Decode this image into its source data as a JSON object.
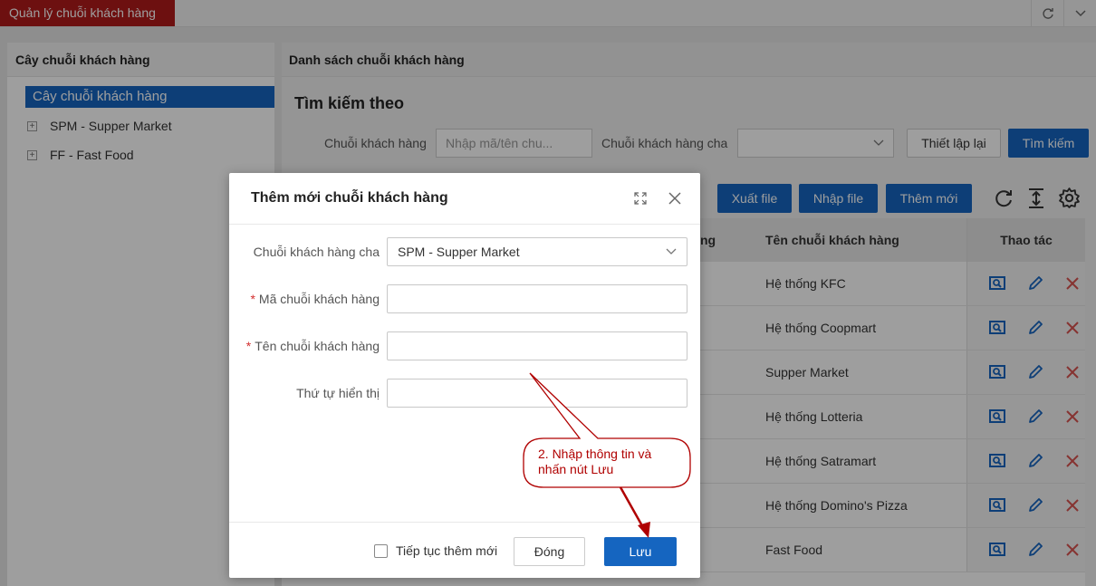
{
  "topbar": {
    "active_tab": "Quản lý chuỗi khách hàng",
    "icons": [
      "refresh-icon",
      "chevron-down-icon"
    ]
  },
  "left": {
    "title": "Cây chuỗi khách hàng",
    "root": "Cây chuỗi khách hàng",
    "items": [
      {
        "label": "SPM - Supper Market"
      },
      {
        "label": "FF - Fast Food"
      }
    ]
  },
  "right": {
    "title": "Danh sách chuỗi khách hàng",
    "search": {
      "title": "Tìm kiếm theo",
      "chain_label": "Chuỗi khách hàng",
      "chain_placeholder": "Nhập mã/tên chu...",
      "parent_label": "Chuỗi khách hàng cha",
      "parent_value": "",
      "reset_label": "Thiết lập lại",
      "search_label": "Tìm kiếm"
    },
    "toolbar": {
      "export_label": "Xuất file",
      "import_label": "Nhập file",
      "add_label": "Thêm mới"
    },
    "table": {
      "col_code_partial": "ng",
      "col_name": "Tên chuỗi khách hàng",
      "col_actions": "Thao tác",
      "rows": [
        "Hệ thống KFC",
        "Hệ thống Coopmart",
        "Supper Market",
        "Hệ thống Lotteria",
        "Hệ thống Satramart",
        "Hệ thống Domino's Pizza",
        "Fast Food"
      ]
    }
  },
  "modal": {
    "title": "Thêm mới chuỗi khách hàng",
    "fields": {
      "parent_label": "Chuỗi khách hàng cha",
      "parent_value": "SPM - Supper Market",
      "code_label": "Mã chuỗi khách hàng",
      "code_value": "",
      "name_label": "Tên chuỗi khách hàng",
      "name_value": "",
      "order_label": "Thứ tự hiển thị",
      "order_value": ""
    },
    "continue_label": "Tiếp tục thêm mới",
    "close_label": "Đóng",
    "save_label": "Lưu"
  },
  "callout": {
    "text": "2. Nhập thông tin và nhấn nút Lưu"
  },
  "colors": {
    "brand_red": "#b01a1a",
    "primary_blue": "#1565c0",
    "action_delete": "#d9534f",
    "callout_red": "#b00000"
  }
}
